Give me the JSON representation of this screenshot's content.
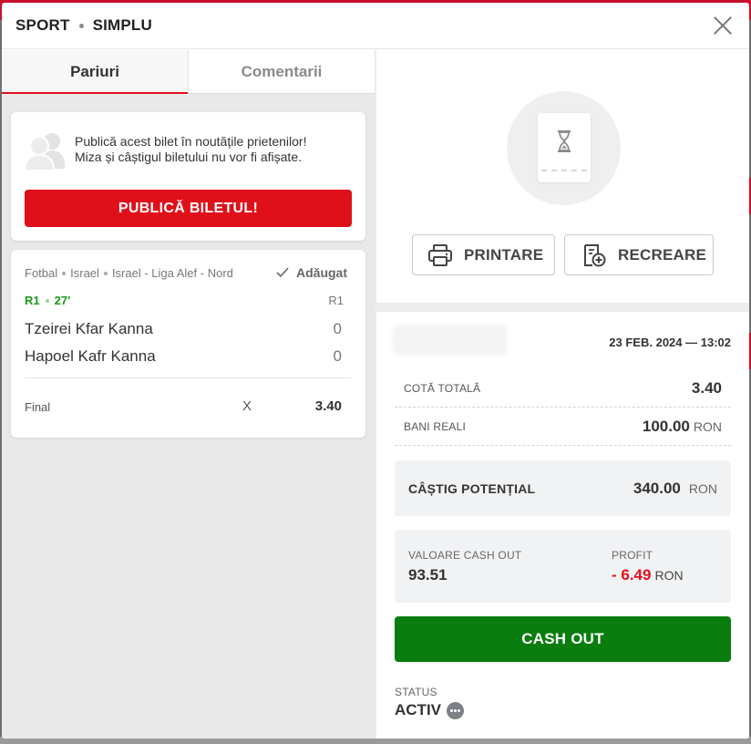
{
  "header": {
    "title_left": "SPORT",
    "title_right": "SIMPLU"
  },
  "tabs": [
    {
      "label": "Pariuri",
      "active": true
    },
    {
      "label": "Comentarii",
      "active": false
    }
  ],
  "publish": {
    "line1": "Publică acest bilet în noutățile prietenilor!",
    "line2": "Miza și câștigul biletului nu vor fi afișate.",
    "button_label": "PUBLICĂ BILETUL!"
  },
  "event": {
    "breadcrumb": [
      "Fotbal",
      "Israel",
      "Israel - Liga Alef - Nord"
    ],
    "added_label": "Adăugat",
    "live_period": "R1",
    "live_minute": "27'",
    "period_right": "R1",
    "teams": [
      {
        "name": "Tzeirei Kfar Kanna",
        "score": "0"
      },
      {
        "name": "Hapoel Kafr Kanna",
        "score": "0"
      }
    ],
    "market_label": "Final",
    "pick": "X",
    "odd": "3.40"
  },
  "actions": {
    "print_label": "PRINTARE",
    "recreate_label": "RECREARE"
  },
  "summary": {
    "date": "23 FEB. 2024 — 13:02",
    "total_odds_label": "COTĂ TOTALĂ",
    "total_odds_value": "3.40",
    "stake_label": "BANI REALI",
    "stake_value": "100.00",
    "currency": "RON",
    "potential_label": "CÂȘTIG POTENȚIAL",
    "potential_value": "340.00",
    "cashout_value_label": "VALOARE CASH OUT",
    "cashout_value": "93.51",
    "profit_label": "PROFIT",
    "profit_value": "- 6.49",
    "cashout_button": "CASH OUT",
    "status_label": "STATUS",
    "status_value": "ACTIV"
  },
  "colors": {
    "brand_red": "#e0101a",
    "cashout_green": "#0a7d0f",
    "live_green": "#1a9a1a"
  }
}
